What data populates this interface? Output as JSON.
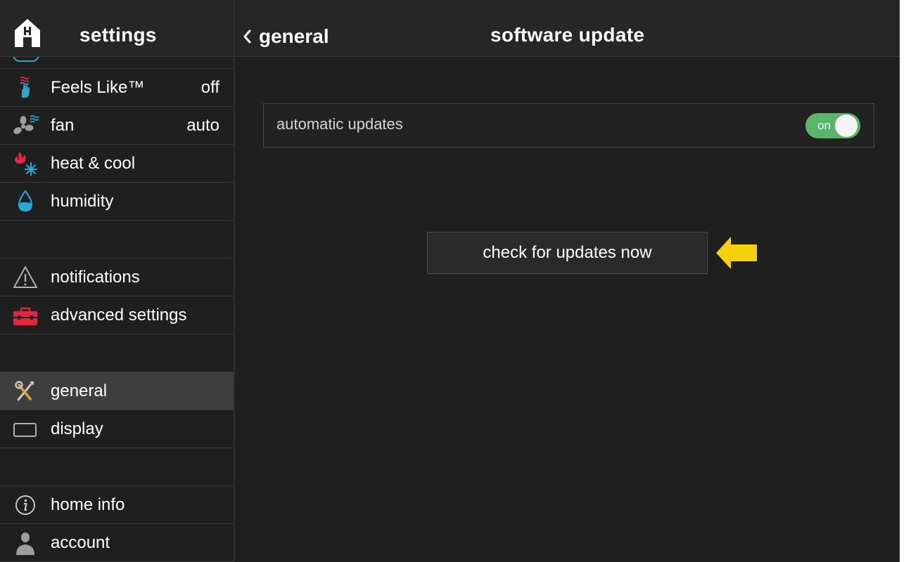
{
  "sidebar": {
    "title": "settings",
    "items": [
      {
        "label": "Feels Like™",
        "value": "off",
        "icon": "feels-like-icon"
      },
      {
        "label": "fan",
        "value": "auto",
        "icon": "fan-icon"
      },
      {
        "label": "heat & cool",
        "value": "",
        "icon": "heat-cool-icon"
      },
      {
        "label": "humidity",
        "value": "",
        "icon": "humidity-drop-icon"
      },
      {
        "label": "notifications",
        "value": "",
        "icon": "warning-triangle-icon"
      },
      {
        "label": "advanced settings",
        "value": "",
        "icon": "toolbox-icon"
      },
      {
        "label": "general",
        "value": "",
        "icon": "tools-icon",
        "active": true
      },
      {
        "label": "display",
        "value": "",
        "icon": "display-icon"
      },
      {
        "label": "home info",
        "value": "",
        "icon": "info-icon"
      },
      {
        "label": "account",
        "value": "",
        "icon": "person-icon"
      }
    ]
  },
  "header": {
    "back_label": "general",
    "title": "software update"
  },
  "automatic_updates": {
    "label": "automatic updates",
    "toggle_text": "on",
    "enabled": true
  },
  "check_button": {
    "label": "check for updates now"
  },
  "colors": {
    "background": "#1f1f1f",
    "active_row": "#3e3e3e",
    "toggle_on": "#5bb46b",
    "pointer_arrow": "#f5d10a",
    "water_blue": "#29a8d6",
    "alert_red": "#e2263f"
  }
}
